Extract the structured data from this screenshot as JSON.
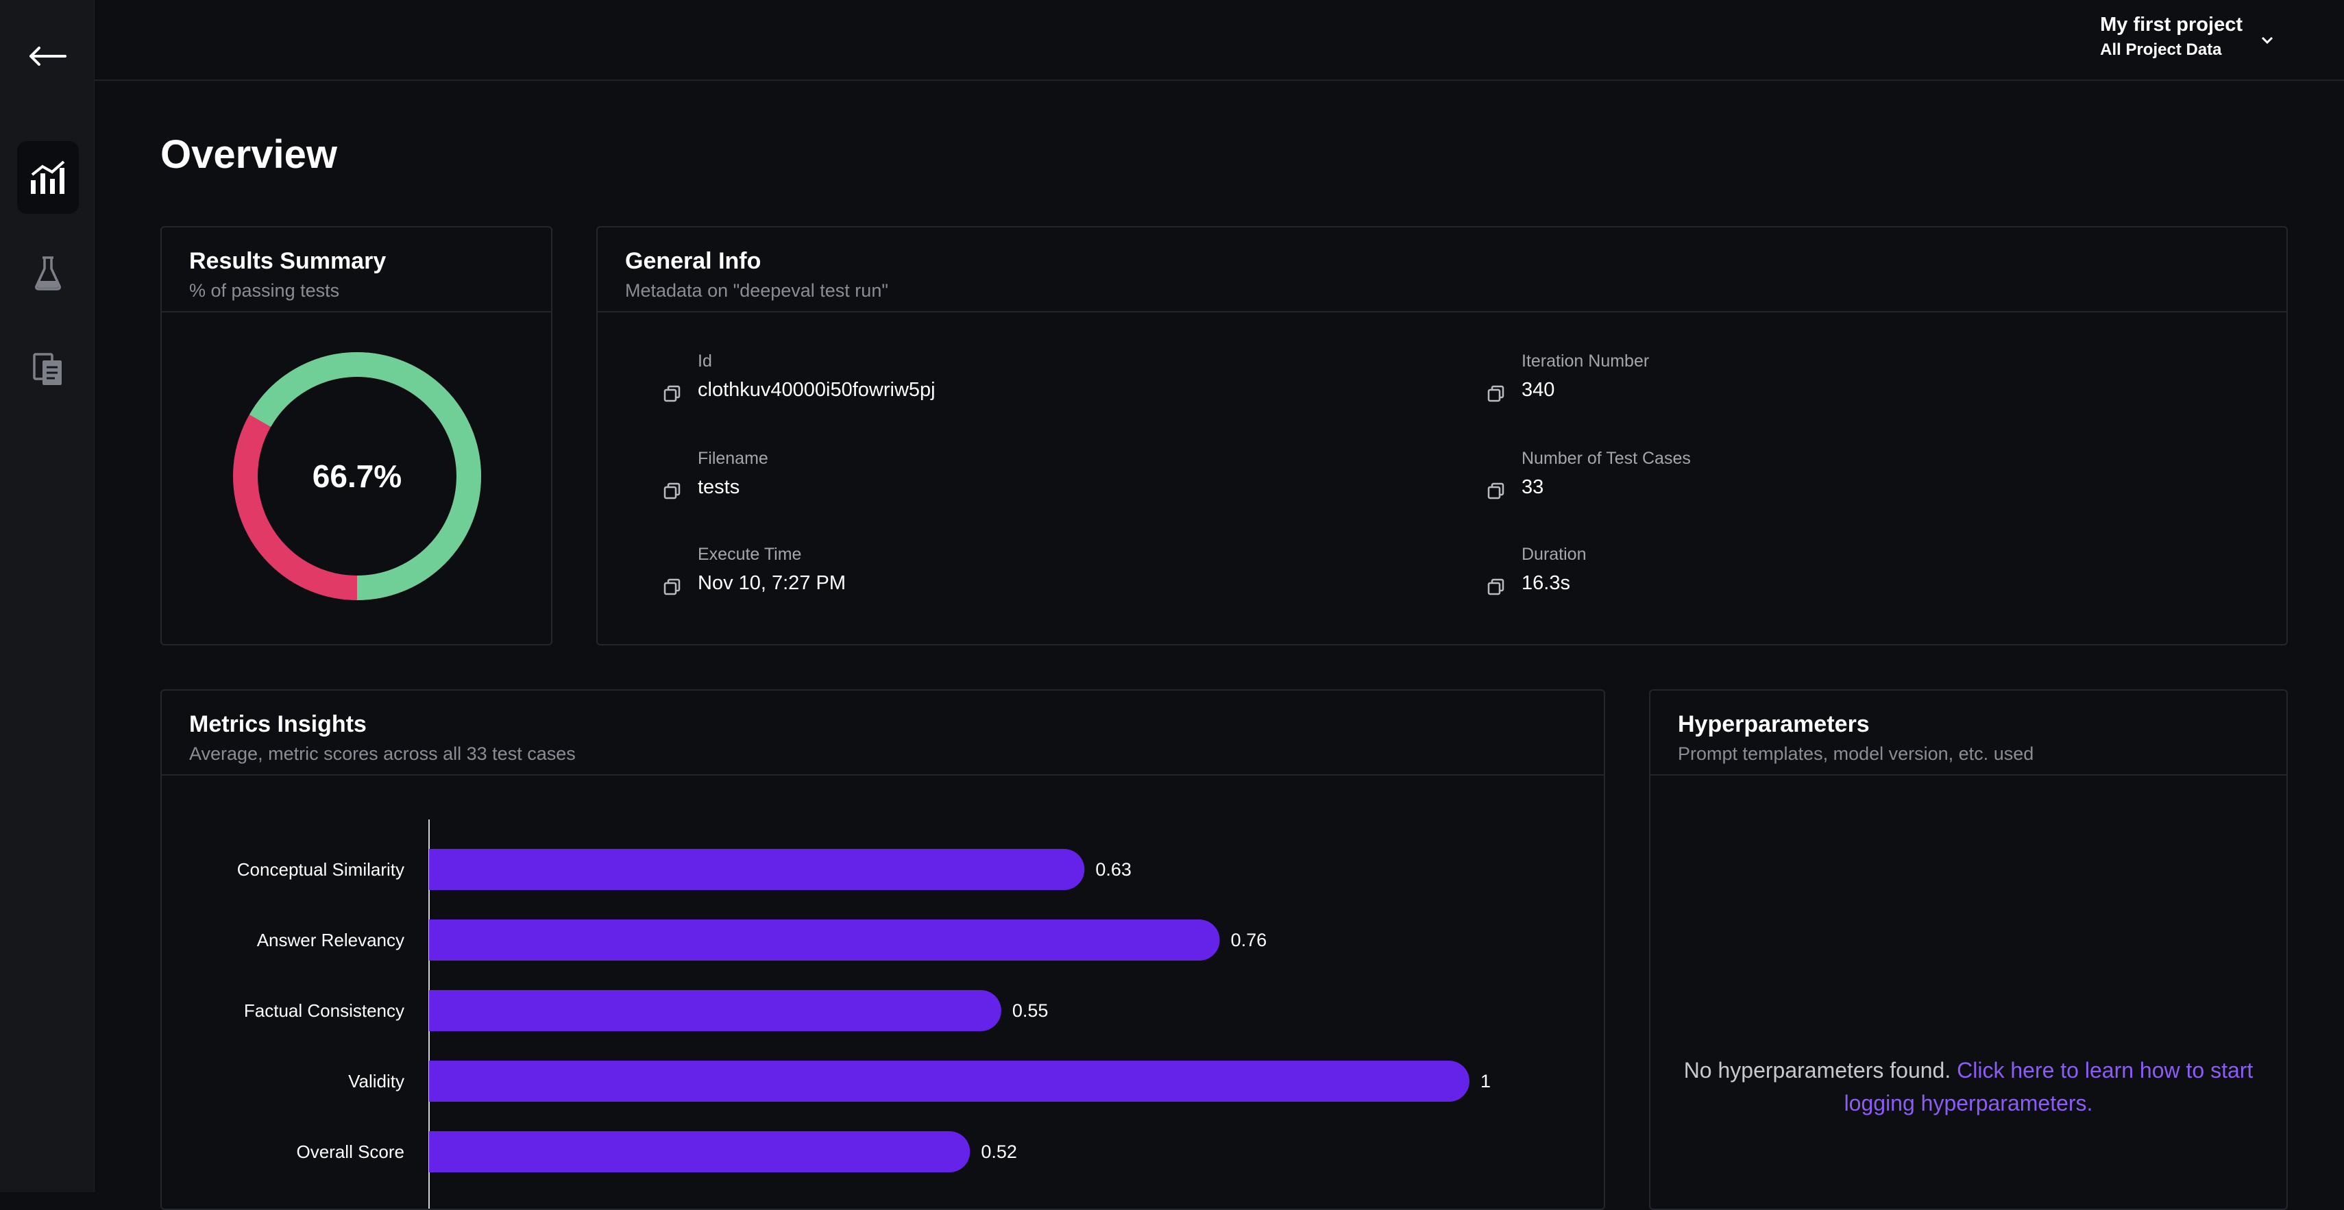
{
  "project": {
    "name": "My first project",
    "scope": "All Project Data"
  },
  "page": {
    "title": "Overview"
  },
  "results_summary": {
    "title": "Results Summary",
    "subtitle": "% of passing tests",
    "pass_fraction": 0.667,
    "label": "66.7%",
    "colors": {
      "pass": "#6fcf97",
      "fail": "#e13a67"
    }
  },
  "general_info": {
    "title": "General Info",
    "subtitle": "Metadata on \"deepeval test run\"",
    "fields": [
      {
        "label": "Id",
        "value": "clothkuv40000i50fowriw5pj"
      },
      {
        "label": "Iteration Number",
        "value": "340"
      },
      {
        "label": "Filename",
        "value": "tests"
      },
      {
        "label": "Number of Test Cases",
        "value": "33"
      },
      {
        "label": "Execute Time",
        "value": "Nov 10, 7:27 PM"
      },
      {
        "label": "Duration",
        "value": "16.3s"
      }
    ]
  },
  "metrics_insights": {
    "title": "Metrics Insights",
    "subtitle": "Average, metric scores across all 33 test cases"
  },
  "chart_data": {
    "type": "bar",
    "orientation": "horizontal",
    "categories": [
      "Conceptual Similarity",
      "Answer Relevancy",
      "Factual Consistency",
      "Validity",
      "Overall Score"
    ],
    "values": [
      0.63,
      0.76,
      0.55,
      1,
      0.52
    ],
    "value_labels": [
      "0.63",
      "0.76",
      "0.55",
      "1",
      "0.52"
    ],
    "xlim": [
      0,
      1
    ],
    "bar_color": "#6522e8",
    "grid": false
  },
  "hyperparameters": {
    "title": "Hyperparameters",
    "subtitle": "Prompt templates, model version, etc. used",
    "empty_text": "No hyperparameters found.",
    "link_text": "Click here to learn how to start logging hyperparameters."
  },
  "icons": {
    "back": "arrow-left-icon",
    "nav": [
      "bar-chart-icon",
      "flask-icon",
      "documents-icon"
    ],
    "copy": "copy-icon",
    "chevron": "chevron-down-icon"
  },
  "colors": {
    "background": "#0d0e11",
    "sidebar": "#15171b",
    "border": "#23262d",
    "muted_text": "#8a8d95",
    "accent": "#8b5cf6"
  }
}
